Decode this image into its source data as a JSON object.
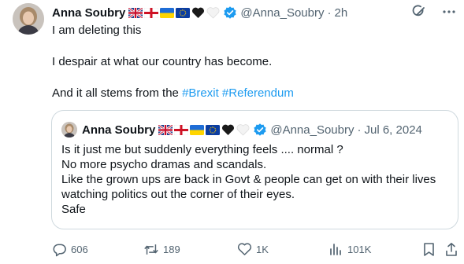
{
  "post": {
    "author": {
      "name": "Anna Soubry",
      "handle": "@Anna_Soubry",
      "time": "2h",
      "emoji_badges": [
        "uk-flag",
        "england-flag",
        "ukraine-flag",
        "eu-flag",
        "black-heart",
        "white-heart"
      ],
      "verified": true
    },
    "body": {
      "line1": "I am deleting this",
      "line2": "I despair at what our country has become.",
      "line3_prefix": "And it all stems from the ",
      "hashtag1": "#Brexit",
      "hashtag2": "#Referendum"
    },
    "quote": {
      "author": {
        "name": "Anna Soubry",
        "handle": "@Anna_Soubry",
        "date": "Jul 6, 2024"
      },
      "lines": [
        "Is it just me but suddenly everything feels  .... normal ?",
        "No more psycho dramas and scandals.",
        "Like the grown ups are back in Govt & people can get on with their lives",
        "watching politics out the corner of their eyes.",
        "Safe"
      ]
    },
    "actions": {
      "replies": "606",
      "reposts": "189",
      "likes": "1K",
      "views": "101K"
    },
    "colors": {
      "link": "#1d9bf0",
      "muted": "#536471",
      "verified": "#1d9bf0",
      "border": "#cfd9de"
    },
    "separator": "·"
  }
}
